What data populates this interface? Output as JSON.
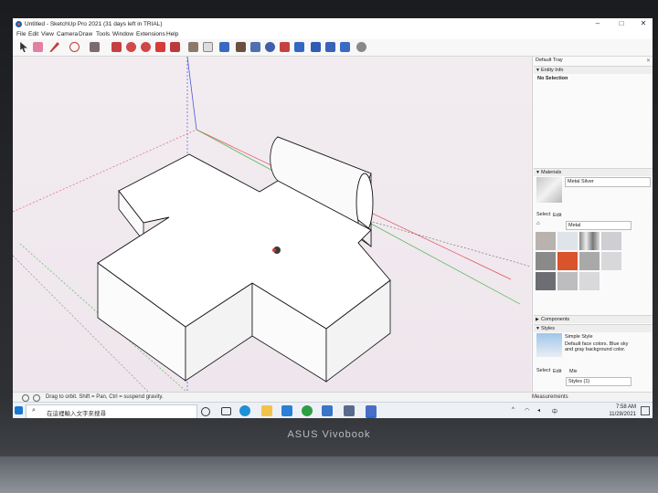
{
  "window": {
    "title": "Untitled - SketchUp Pro 2021 (31 days left in TRIAL)",
    "min": "–",
    "max": "□",
    "close": "✕"
  },
  "menu": [
    "File",
    "Edit",
    "View",
    "Camera",
    "Draw",
    "Tools",
    "Window",
    "Extensions",
    "Help"
  ],
  "tray": {
    "title": "Default Tray",
    "entity_info": {
      "label": "Entity Info",
      "value": "No Selection"
    },
    "materials": {
      "label": "Materials",
      "current": "Metal Silver",
      "tab_select": "Select",
      "tab_edit": "Edit",
      "library": "Metal"
    },
    "components": {
      "label": "Components"
    },
    "styles": {
      "label": "Styles",
      "name": "Simple Style",
      "description": "Default face colors. Blue sky and gray background color.",
      "tab_select": "Select",
      "tab_edit": "Edit",
      "tab_mix": "Mix",
      "library": "Styles (1)"
    }
  },
  "status": {
    "message": "Drag to orbit. Shift = Pan, Ctrl = suspend gravity.",
    "measurements_label": "Measurements"
  },
  "taskbar": {
    "search_placeholder": "在這裡輸入文字來搜尋",
    "time": "7:58 AM",
    "date": "11/28/2021"
  },
  "device": {
    "brand": "ASUS Vivobook"
  },
  "colors": {
    "accent": "#1d5ea8",
    "axis_red": "#e0505a",
    "axis_green": "#46b04a",
    "axis_blue": "#4a5ad8"
  }
}
